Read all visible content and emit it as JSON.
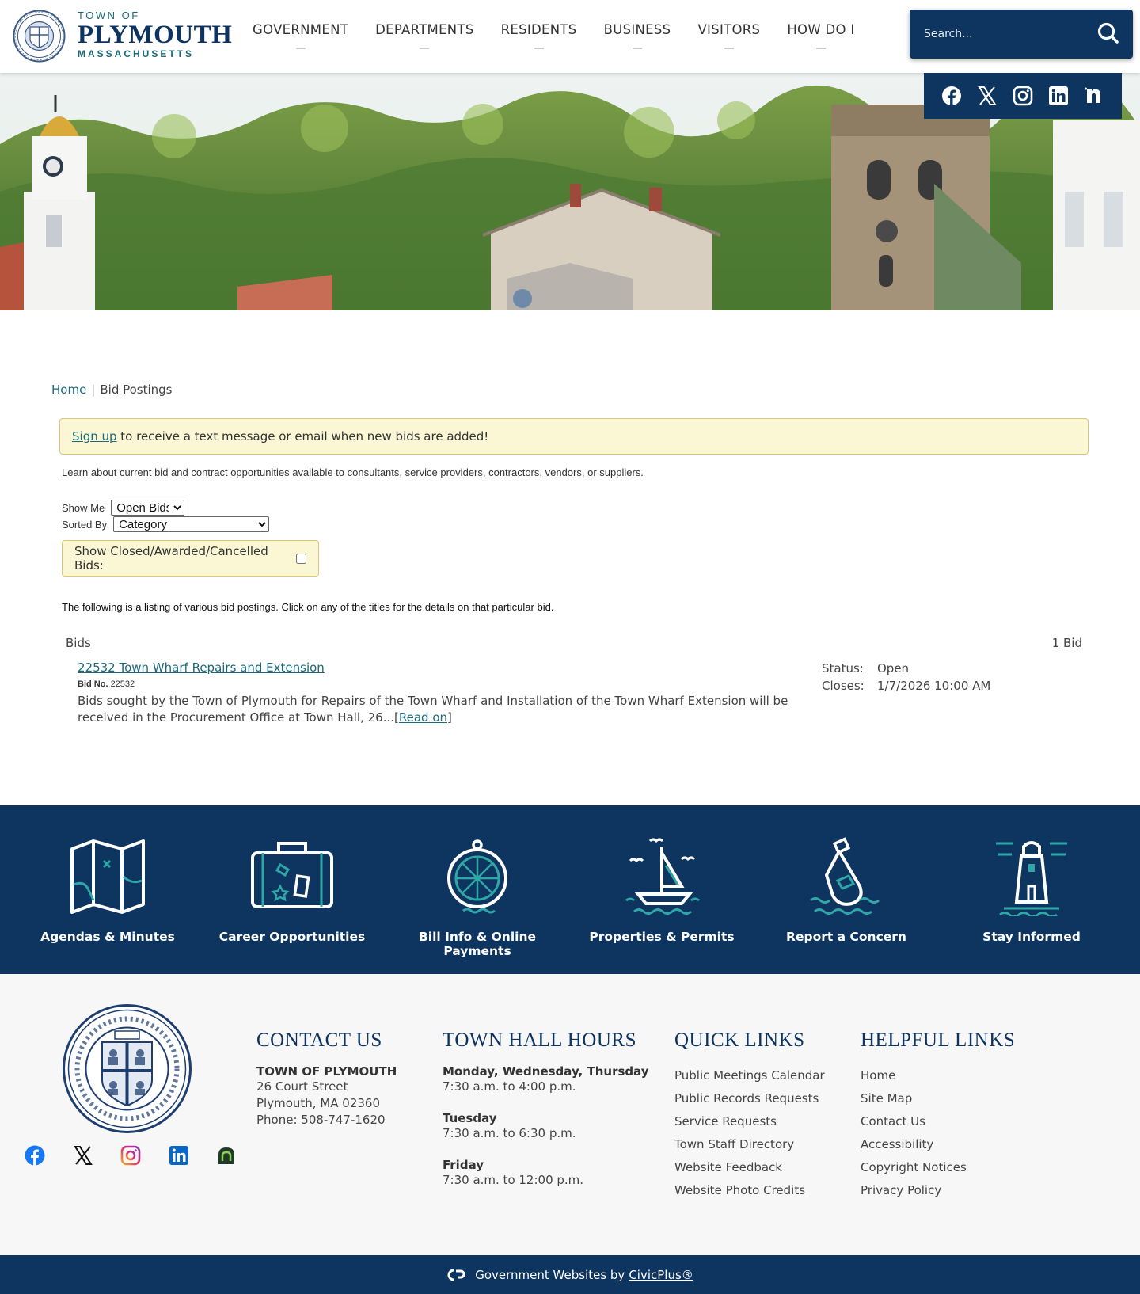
{
  "header": {
    "logo": {
      "town_of": "TOWN OF",
      "name": "PLYMOUTH",
      "state": "MASSACHUSETTS"
    },
    "nav": [
      {
        "label": "GOVERNMENT"
      },
      {
        "label": "DEPARTMENTS"
      },
      {
        "label": "RESIDENTS"
      },
      {
        "label": "BUSINESS"
      },
      {
        "label": "VISITORS"
      },
      {
        "label": "HOW DO I"
      }
    ],
    "search": {
      "placeholder": "Search..."
    }
  },
  "social": [
    "facebook-icon",
    "x-icon",
    "instagram-icon",
    "linkedin-icon",
    "nextdoor-icon"
  ],
  "colors": {
    "navy": "#0e3460",
    "teal": "#1b6a7a",
    "notice_bg": "#fbf7d4"
  },
  "breadcrumb": {
    "home": "Home",
    "separator": "|",
    "current": "Bid Postings"
  },
  "notice": {
    "link": "Sign up",
    "text": " to receive a text message or email when new bids are added!"
  },
  "intro": "Learn about current bid and contract opportunities available to consultants, service providers, contractors, vendors, or suppliers.",
  "filters": {
    "show_me_label": "Show Me",
    "show_me_value": "Open Bids",
    "sorted_by_label": "Sorted By",
    "sorted_by_value": "Category",
    "closed_label": "Show Closed/Awarded/Cancelled Bids:"
  },
  "listing_note": "The following is a listing of various bid postings. Click on any of the titles for the details on that particular bid.",
  "bids": {
    "heading": "Bids",
    "count": "1 Bid",
    "items": [
      {
        "title": "22532 Town Wharf Repairs and Extension",
        "bid_no_label": "Bid No.",
        "bid_no": "22532",
        "description": "Bids sought by the Town of Plymouth for Repairs of the Town Wharf and Installation of the Town Wharf Extension will be received in the Procurement Office at Town Hall, 26...",
        "read_on": "Read on",
        "status_label": "Status:",
        "status": "Open",
        "closes_label": "Closes:",
        "closes": "1/7/2026 10:00 AM"
      }
    ]
  },
  "tiles": [
    {
      "label": "Agendas & Minutes",
      "icon": "map-icon"
    },
    {
      "label": "Career Opportunities",
      "icon": "suitcase-icon"
    },
    {
      "label": "Bill Info & Online Payments",
      "icon": "compass-icon"
    },
    {
      "label": "Properties & Permits",
      "icon": "sailboat-icon"
    },
    {
      "label": "Report a Concern",
      "icon": "message-bottle-icon"
    },
    {
      "label": "Stay Informed",
      "icon": "lighthouse-icon"
    }
  ],
  "footer": {
    "contact": {
      "heading": "CONTACT US",
      "org": "TOWN OF PLYMOUTH",
      "street": "26 Court Street",
      "city": "Plymouth, MA 02360",
      "phone": "Phone: 508-747-1620"
    },
    "hours": {
      "heading": "TOWN HALL HOURS",
      "blocks": [
        {
          "days": "Monday, Wednesday, Thursday",
          "time": "7:30 a.m. to 4:00 p.m."
        },
        {
          "days": "Tuesday",
          "time": "7:30 a.m. to 6:30 p.m."
        },
        {
          "days": "Friday",
          "time": "7:30 a.m. to 12:00 p.m."
        }
      ]
    },
    "quick_links": {
      "heading": "QUICK LINKS",
      "items": [
        "Public Meetings Calendar",
        "Public Records Requests",
        "Service Requests",
        "Town Staff Directory",
        "Website Feedback",
        "Website Photo Credits"
      ]
    },
    "helpful_links": {
      "heading": "HELPFUL LINKS",
      "items": [
        "Home",
        "Site Map",
        "Contact Us",
        "Accessibility",
        "Copyright Notices",
        "Privacy Policy"
      ]
    }
  },
  "bottom": {
    "text": "Government Websites by",
    "link": "CivicPlus®"
  }
}
